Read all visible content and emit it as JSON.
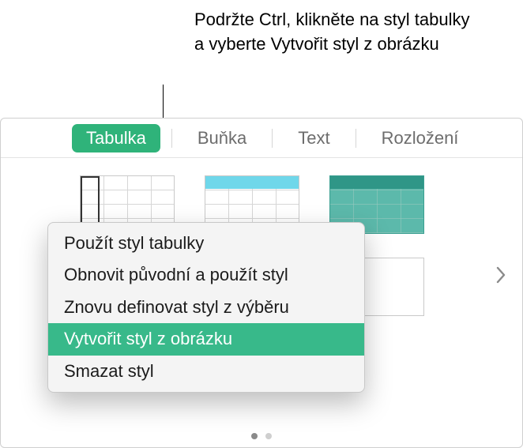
{
  "callout": {
    "text": "Podržte Ctrl, klikněte na styl tabulky a vyberte Vytvořit styl z obrázku"
  },
  "tabs": {
    "items": [
      {
        "label": "Tabulka",
        "active": true
      },
      {
        "label": "Buňka",
        "active": false
      },
      {
        "label": "Text",
        "active": false
      },
      {
        "label": "Rozložení",
        "active": false
      }
    ]
  },
  "context_menu": {
    "items": [
      {
        "label": "Použít styl tabulky",
        "highlighted": false
      },
      {
        "label": "Obnovit původní a použít styl",
        "highlighted": false
      },
      {
        "label": "Znovu definovat styl z výběru",
        "highlighted": false
      },
      {
        "label": "Vytvořit styl z obrázku",
        "highlighted": true
      },
      {
        "label": "Smazat styl",
        "highlighted": false
      }
    ]
  },
  "icons": {
    "chevron_right": "chevron-right"
  }
}
